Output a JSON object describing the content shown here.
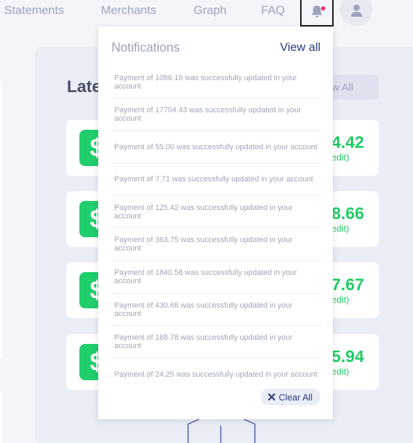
{
  "nav": {
    "items": [
      "Statements",
      "Merchants",
      "Graph",
      "FAQ"
    ]
  },
  "main": {
    "title_partial": "Late",
    "view_all_partial": "ew All",
    "transactions": [
      {
        "amount_partial": "4.42",
        "type_partial": "edit)"
      },
      {
        "amount_partial": "8.66",
        "type_partial": "edit)"
      },
      {
        "amount_partial": "7.67",
        "type_partial": "edit)"
      },
      {
        "amount_partial": "5.94",
        "type_partial": "edit)"
      }
    ],
    "icon_symbol": "$"
  },
  "notifications": {
    "title": "Notifications",
    "view_all": "View all",
    "items": [
      "Payment of 1086.16 was successfully updated in your account",
      "Payment of 17704.43 was successfully updated in your account",
      "Payment of 55.00 was successfully updated in your account",
      "Payment of 7.71 was successfully updated in your account",
      "Payment of 125.42 was successfully updated in your account",
      "Payment of 363.75 was successfully updated in your account",
      "Payment of 1840.58 was successfully updated in your account",
      "Payment of 430.68 was successfully updated in your account",
      "Payment of 168.78 was successfully updated in your account",
      "Payment of 24.25 was successfully updated in your account"
    ],
    "clear_all": "Clear All"
  },
  "colors": {
    "accent_green": "#1fcd64",
    "nav_text": "#9da3bb",
    "link_blue": "#2b3a7a",
    "badge_pink": "#ff2d6f"
  },
  "icons": {
    "bell": "bell-icon",
    "user": "user-icon",
    "clear": "x-icon",
    "dollar": "dollar-icon"
  }
}
